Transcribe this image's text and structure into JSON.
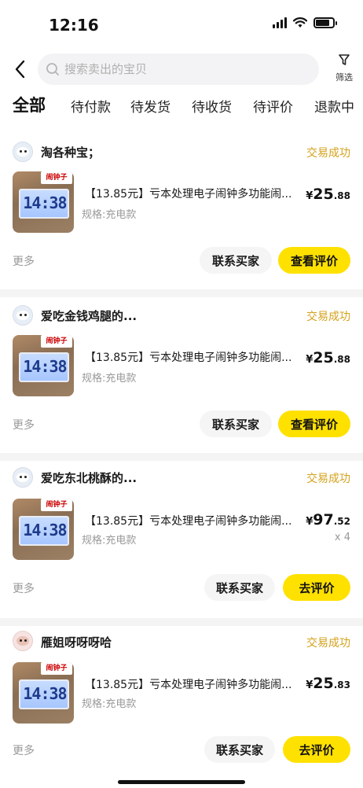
{
  "status_bar": {
    "time": "12:16"
  },
  "search": {
    "placeholder": "搜索卖出的宝贝"
  },
  "filter": {
    "label": "筛选"
  },
  "tabs": [
    {
      "label": "全部",
      "active": true
    },
    {
      "label": "待付款"
    },
    {
      "label": "待发货"
    },
    {
      "label": "待收货"
    },
    {
      "label": "待评价"
    },
    {
      "label": "退款中"
    }
  ],
  "orders": [
    {
      "shop": "淘各种宝；",
      "status": "交易成功",
      "title": "【13.85元】亏本处理电子闹钟多功能闹...",
      "spec": "规格:充电款",
      "price_symbol": "¥",
      "price_int": "25",
      "price_dec": ".88",
      "more": "更多",
      "contact_label": "联系买家",
      "action_label": "查看评价"
    },
    {
      "shop": "爱吃金钱鸡腿的...",
      "status": "交易成功",
      "title": "【13.85元】亏本处理电子闹钟多功能闹...",
      "spec": "规格:充电款",
      "price_symbol": "¥",
      "price_int": "25",
      "price_dec": ".88",
      "more": "更多",
      "contact_label": "联系买家",
      "action_label": "查看评价"
    },
    {
      "shop": "爱吃东北桃酥的...",
      "status": "交易成功",
      "title": "【13.85元】亏本处理电子闹钟多功能闹...",
      "spec": "规格:充电款",
      "price_symbol": "¥",
      "price_int": "97",
      "price_dec": ".52",
      "quantity": "x 4",
      "more": "更多",
      "contact_label": "联系买家",
      "action_label": "去评价"
    },
    {
      "shop": "雁姐呀呀呀哈",
      "status": "交易成功",
      "title": "【13.85元】亏本处理电子闹钟多功能闹...",
      "spec": "规格:充电款",
      "price_symbol": "¥",
      "price_int": "25",
      "price_dec": ".83",
      "more": "更多",
      "contact_label": "联系买家",
      "action_label": "去评价"
    }
  ],
  "product_image": {
    "clock_digits": "14:38",
    "sticker_text": "闹钟子"
  },
  "colors": {
    "accent": "#ffe100",
    "status": "#d4a21c"
  }
}
